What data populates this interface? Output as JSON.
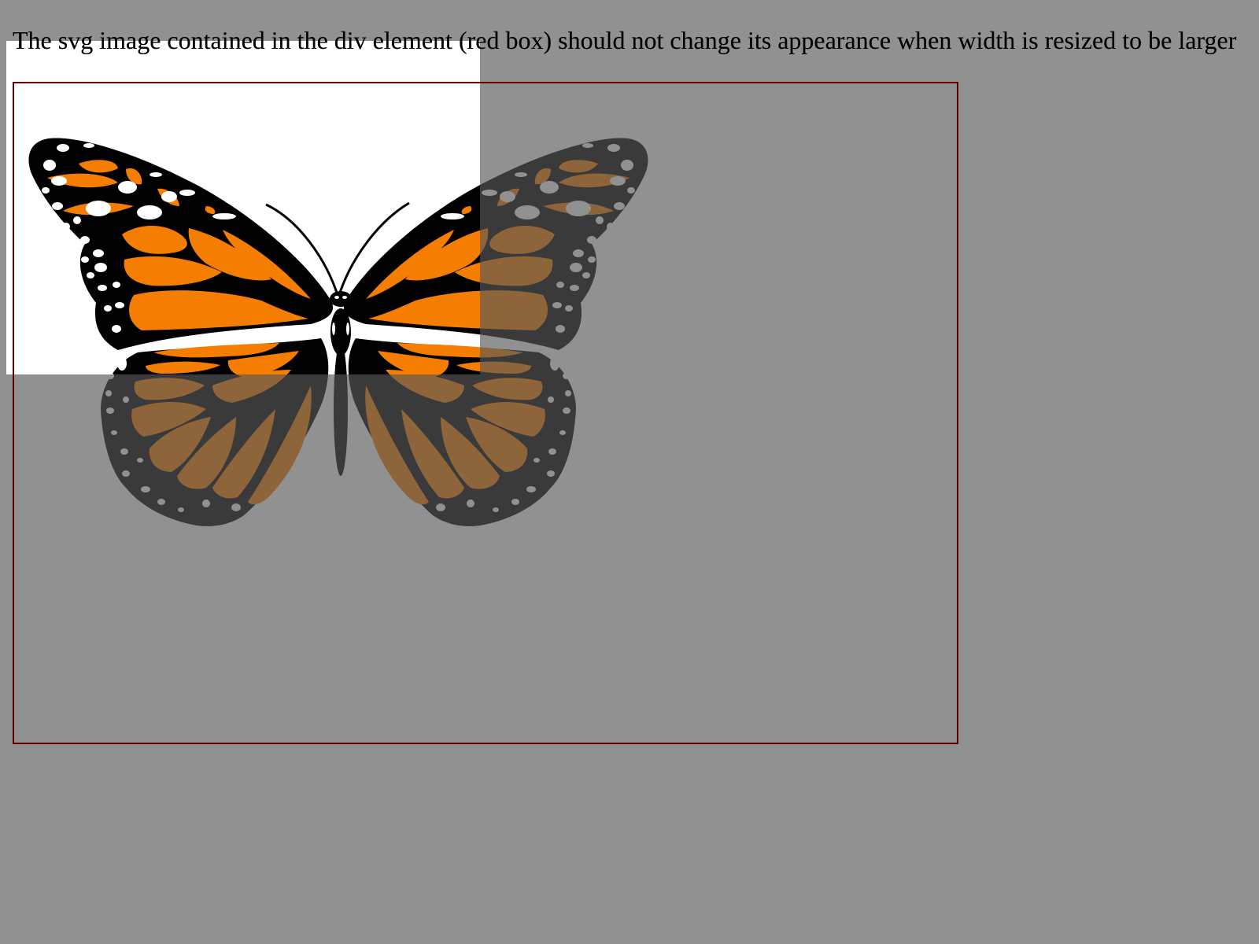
{
  "instruction_text": "The svg image contained in the div element (red box) should not change its appearance when width is resized to be larger",
  "colors": {
    "page_background": "#ffffff",
    "dim_overlay": "#585858",
    "red_box_border": "#dd0000",
    "wing_orange": "#f57d00",
    "wing_black": "#000000",
    "wing_spots": "#ffffff"
  },
  "icons": {
    "butterfly": "monarch-butterfly-icon"
  }
}
